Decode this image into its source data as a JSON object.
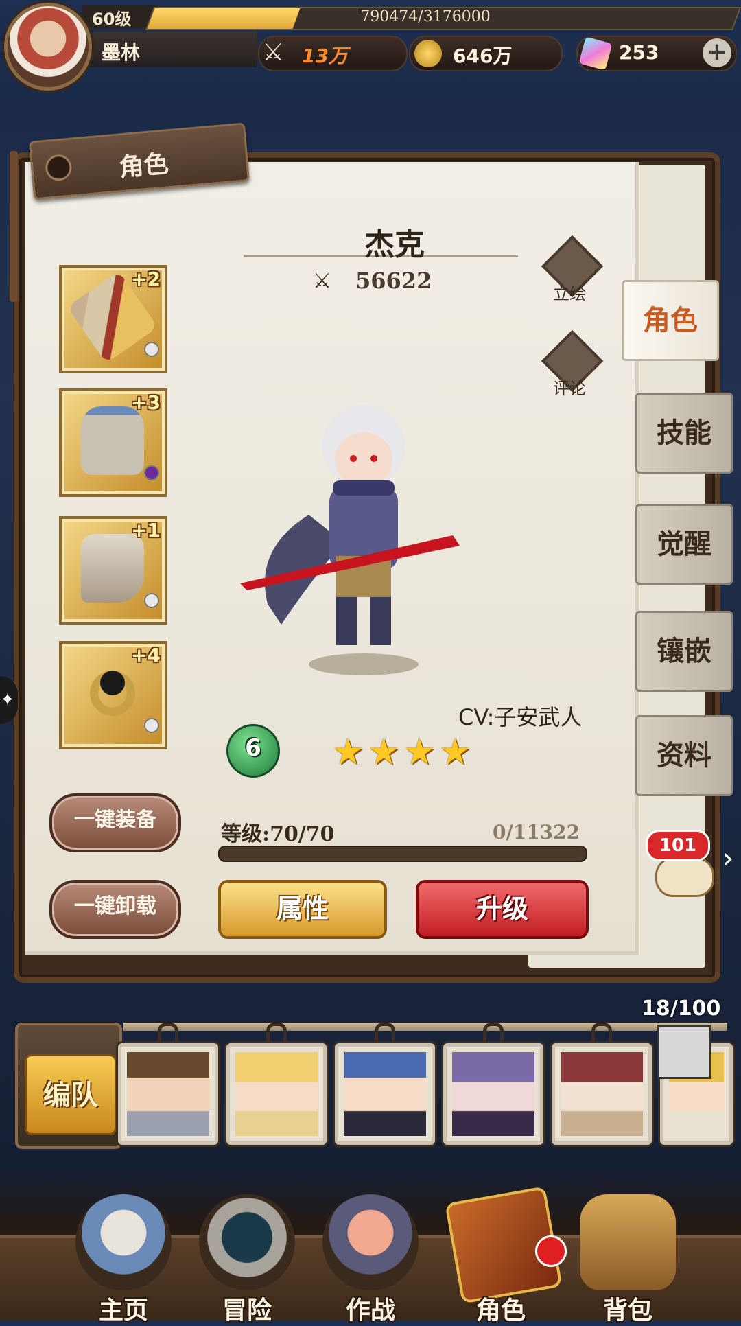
{
  "player": {
    "level": "60级",
    "exp_text": "790474/3176000",
    "exp_fraction": 0.2489,
    "name": "墨林"
  },
  "resources": {
    "power": "13万",
    "gold": "646万",
    "gems": "253",
    "add": "+"
  },
  "panel": {
    "title": "角色"
  },
  "character": {
    "name": "杰克",
    "power": "56622",
    "cv": "CV:子安武人",
    "awaken_level": "6",
    "stars": 4,
    "level_text": "等级:70/70",
    "xp_text": "0/11322",
    "xp_fraction": 0
  },
  "equipment": [
    {
      "plus": "+2",
      "icon": "sword-icon"
    },
    {
      "plus": "+3",
      "icon": "armor-icon"
    },
    {
      "plus": "+1",
      "icon": "boots-icon"
    },
    {
      "plus": "+4",
      "icon": "ring-icon"
    }
  ],
  "side_buttons": {
    "portrait": "立绘",
    "comment": "评论"
  },
  "buttons": {
    "equip_all": "一键装备",
    "unequip_all": "一键卸载",
    "attributes": "属性",
    "upgrade": "升级"
  },
  "tabs": [
    "角色",
    "技能",
    "觉醒",
    "镶嵌",
    "资料"
  ],
  "chat": {
    "count": "101"
  },
  "roster": {
    "count": "18/100",
    "team_button": "编队"
  },
  "nav": [
    "主页",
    "冒险",
    "作战",
    "角色",
    "背包"
  ],
  "colors": {
    "accent": "#c85a24",
    "gold_button": "#e6b23c",
    "red_button": "#d8363a"
  }
}
